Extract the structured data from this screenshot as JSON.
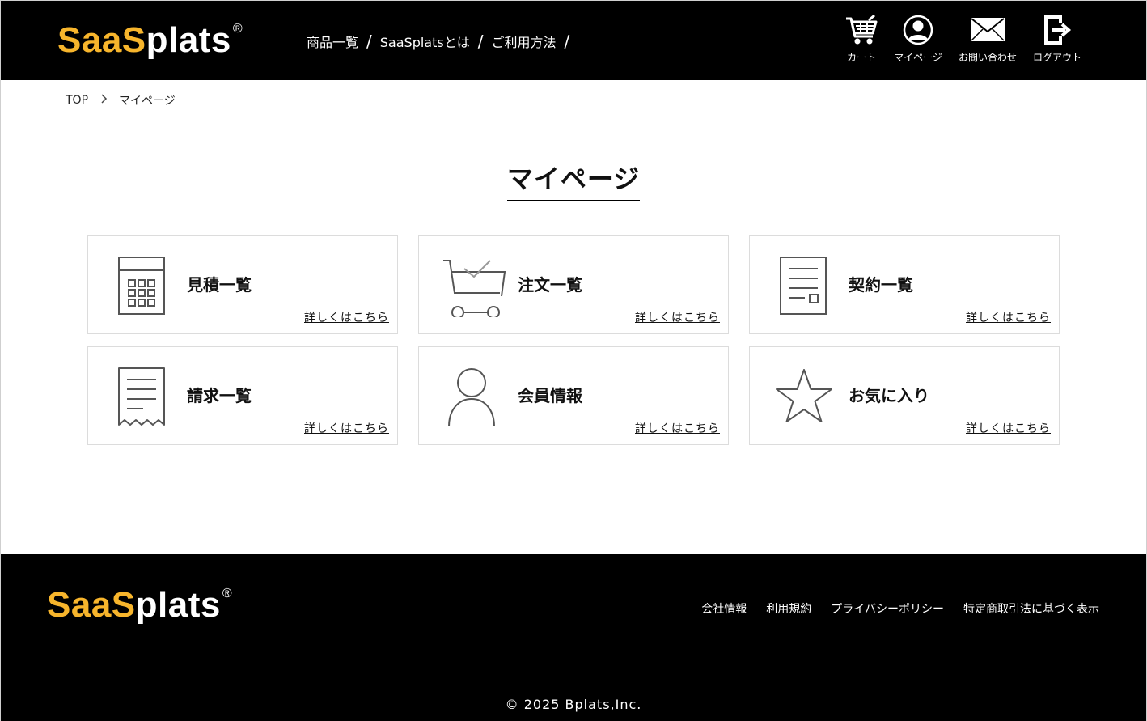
{
  "header": {
    "logo": {
      "part1": "SaaS",
      "part2": "plats",
      "reg": "®"
    },
    "nav": [
      {
        "label": "商品一覧",
        "sep": "/"
      },
      {
        "label": "SaaSplatsとは",
        "sep": "/"
      },
      {
        "label": "ご利用方法",
        "sep": "/"
      }
    ],
    "icons": [
      {
        "icon": "cart-icon",
        "label": "カート"
      },
      {
        "icon": "user-icon",
        "label": "マイページ"
      },
      {
        "icon": "mail-icon",
        "label": "お問い合わせ"
      },
      {
        "icon": "logout-icon",
        "label": "ログアウト"
      }
    ]
  },
  "breadcrumb": {
    "home": "TOP",
    "current": "マイページ",
    "separator": ">"
  },
  "page": {
    "title": "マイページ"
  },
  "cards": [
    {
      "icon": "calculator-icon",
      "title": "見積一覧",
      "link": "詳しくはこちら"
    },
    {
      "icon": "cart-check-icon",
      "title": "注文一覧",
      "link": "詳しくはこちら"
    },
    {
      "icon": "contract-document-icon",
      "title": "契約一覧",
      "link": "詳しくはこちら"
    },
    {
      "icon": "receipt-icon",
      "title": "請求一覧",
      "link": "詳しくはこちら"
    },
    {
      "icon": "person-icon",
      "title": "会員情報",
      "link": "詳しくはこちら"
    },
    {
      "icon": "star-icon",
      "title": "お気に入り",
      "link": "詳しくはこちら"
    }
  ],
  "footer": {
    "logo": {
      "part1": "SaaS",
      "part2": "plats",
      "reg": "®"
    },
    "links": [
      "会社情報",
      "利用規約",
      "プライバシーポリシー",
      "特定商取引法に基づく表示"
    ],
    "copyright": "© 2025 Bplats,Inc."
  },
  "colors": {
    "brand_yellow": "#f7b52c",
    "header_bg": "#000000",
    "card_border": "#dcdcdc",
    "icon_stroke": "#555555"
  }
}
